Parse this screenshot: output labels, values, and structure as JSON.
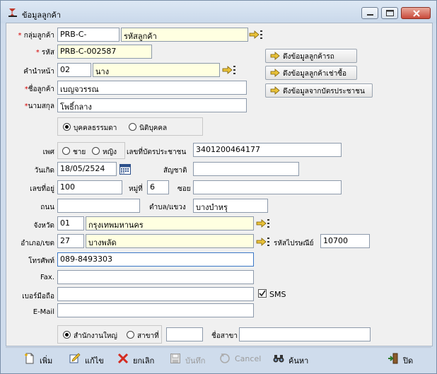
{
  "window": {
    "title": "ข้อมูลลูกค้า"
  },
  "colors": {
    "required": "#d40000",
    "lookup_field": "#ffffe1",
    "focus_border": "#3b78c7"
  },
  "form": {
    "group_label": "กลุ่มลูกค้า",
    "group_code": "PRB-C-",
    "group_name": "รหัสลูกค้า",
    "code_label": "รหัส",
    "code_value": "PRB-C-002587",
    "title_label": "คำนำหน้า",
    "title_code": "02",
    "title_name": "นาง",
    "firstname_label": "ชื่อลูกค้า",
    "firstname_value": "เบญจวรรณ",
    "lastname_label": "นามสกุล",
    "lastname_value": "โพธิ์กลาง",
    "btn_fetch_car": "ดึงข้อมูลลูกค้ารถ",
    "btn_fetch_hire": "ดึงข้อมูลลูกค้าเช่าซื้อ",
    "btn_fetch_idcard": "ดึงข้อมูลจากบัตรประชาชน",
    "person_type": {
      "natural": "บุคคลธรรมดา",
      "juristic": "นิติบุคคล",
      "selected": "บุคคลธรรมดา"
    },
    "sex_label": "เพศ",
    "sex_male": "ชาย",
    "sex_female": "หญิง",
    "idcard_label": "เลขที่บัตรประชาชน",
    "idcard_value": "3401200464177",
    "birthdate_label": "วันเกิด",
    "birthdate_value": "18/05/2524",
    "nationality_label": "สัญชาติ",
    "nationality_value": "",
    "houseno_label": "เลขที่อยู่",
    "houseno_value": "100",
    "moo_label": "หมู่ที่",
    "moo_value": "6",
    "soi_label": "ซอย",
    "soi_value": "",
    "road_label": "ถนน",
    "road_value": "",
    "subdistrict_label": "ตำบล/แขวง",
    "subdistrict_value": "บางบำหรุ",
    "province_label": "จังหวัด",
    "province_code": "01",
    "province_name": "กรุงเทพมหานคร",
    "district_label": "อำเภอ/เขต",
    "district_code": "27",
    "district_name": "บางพลัด",
    "postcode_label": "รหัสไปรษณีย์",
    "postcode_value": "10700",
    "phone_label": "โทรศัพท์",
    "phone_value": "089-8493303",
    "fax_label": "Fax.",
    "fax_value": "",
    "mobile_label": "เบอร์มือถือ",
    "mobile_value": "",
    "sms_label": "SMS",
    "sms_checked": true,
    "email_label": "E-Mail",
    "email_value": "",
    "branch_type": {
      "head": "สำนักงานใหญ่",
      "branch": "สาขาที่",
      "selected": "สำนักงานใหญ่"
    },
    "branch_no_value": "",
    "branch_name_label": "ชื่อสาขา",
    "branch_name_value": ""
  },
  "toolbar": {
    "add": "เพิ่ม",
    "edit": "แก้ไข",
    "cancel_record": "ยกเลิก",
    "save": "บันทึก",
    "cancel": "Cancel",
    "search": "ค้นหา",
    "close": "ปิด"
  }
}
